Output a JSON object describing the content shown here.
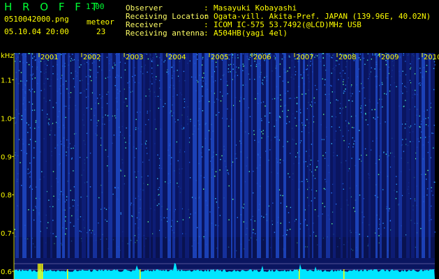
{
  "app": {
    "name": "H R O F F T",
    "version": "1.00"
  },
  "file": {
    "filename": "0510042000.png",
    "datetime": "05.10.04 20:00",
    "meteor_label": "meteor",
    "meteor_count": "23"
  },
  "station": {
    "rows": [
      {
        "label": "Observer",
        "value": "Masayuki Kobayashi"
      },
      {
        "label": "Receiving Location",
        "value": "Ogata-vill. Akita-Pref. JAPAN (139.96E, 40.02N)"
      },
      {
        "label": "Receiver",
        "value": "ICOM IC-575 53.7492(@LCD)MHz USB"
      },
      {
        "label": "Receiving antenna",
        "value": "A504HB(yagi 4el)"
      }
    ],
    "separator": ":"
  },
  "colors": {
    "background": "#000000",
    "text_yellow": "#ffff00",
    "text_green": "#00ff33",
    "spectrum_dark": "#0a1560",
    "spectrum_cyan": "#00ffff",
    "baseline_cyan": "#00e5ff"
  },
  "chart_data": {
    "type": "heatmap",
    "ylabel": "kHz",
    "y_ticks": [
      "1.1",
      "1.0",
      "0.9",
      "0.8",
      "0.7",
      "0.6"
    ],
    "y_tick_values": [
      1.1,
      1.0,
      0.9,
      0.8,
      0.7,
      0.6
    ],
    "ylim": [
      0.58,
      1.17
    ],
    "x_ticks": [
      "2001",
      "2002",
      "2003",
      "2004",
      "2005",
      "2006",
      "2007",
      "2008",
      "2009",
      "2010"
    ],
    "grid": false
  }
}
